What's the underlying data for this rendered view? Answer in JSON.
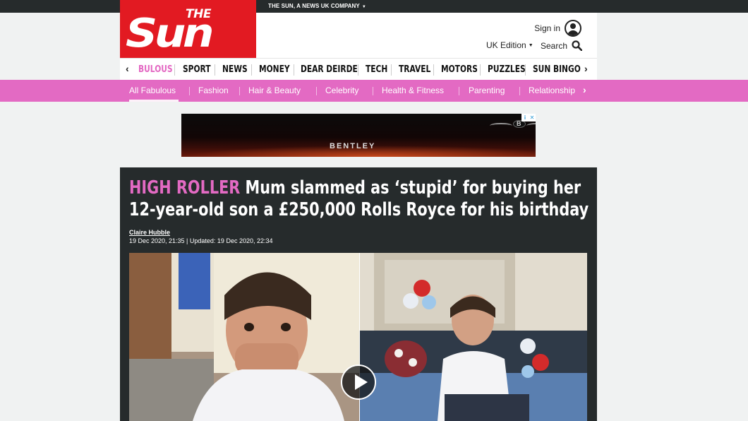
{
  "topbar": {
    "company_label": "THE SUN, A NEWS UK COMPANY"
  },
  "brand": {
    "the": "THE",
    "sun": "Sun",
    "color": "#e21a22",
    "accent_pink": "#e36ac3"
  },
  "account": {
    "signin_label": "Sign in",
    "edition_label": "UK Edition",
    "search_label": "Search"
  },
  "main_nav": {
    "items": [
      "BULOUS",
      "SPORT",
      "NEWS",
      "MONEY",
      "DEAR DEIRDE",
      "TECH",
      "TRAVEL",
      "MOTORS",
      "PUZZLES",
      "SUN BINGO"
    ],
    "active_index": 0
  },
  "sub_nav": {
    "items": [
      "All Fabulous",
      "Fashion",
      "Hair & Beauty",
      "Celebrity",
      "Health & Fitness",
      "Parenting",
      "Relationship"
    ],
    "active_index": 0
  },
  "ad": {
    "brand_text": "BENTLEY"
  },
  "article": {
    "kicker": "HIGH ROLLER",
    "headline": "Mum slammed as ‘stupid’ for buying her 12-year-old son a £250,000 Rolls Royce for his birthday",
    "author": "Claire Hubble",
    "dates": "19 Dec 2020, 21:35 | Updated: 19 Dec 2020, 22:34"
  }
}
